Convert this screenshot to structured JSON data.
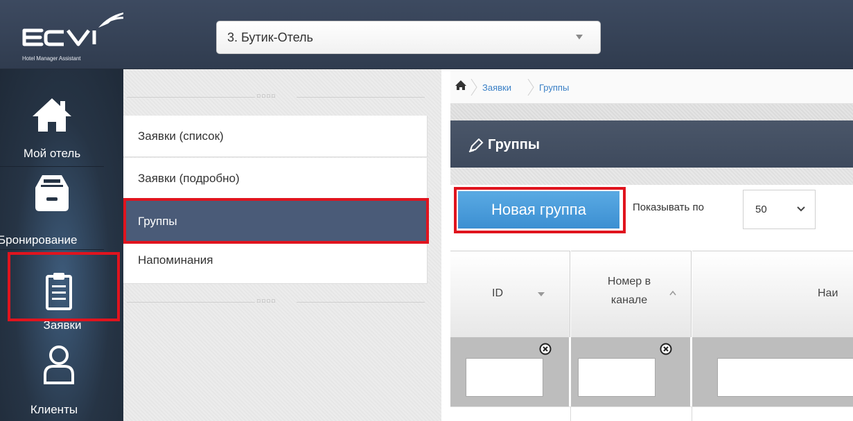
{
  "app": {
    "logo_text": "ECVI",
    "logo_subtitle": "Hotel Manager Assistant"
  },
  "hotel_select": {
    "value": "3. Бутик-Отель"
  },
  "nav": {
    "items": [
      {
        "label": "Мой отель",
        "icon": "home-icon"
      },
      {
        "label": "Бронирование",
        "icon": "inbox-icon"
      },
      {
        "label": "Заявки",
        "icon": "clipboard-icon",
        "active": true
      },
      {
        "label": "Клиенты",
        "icon": "user-icon"
      }
    ]
  },
  "submenu": {
    "items": [
      {
        "label": "Заявки (список)"
      },
      {
        "label": "Заявки (подробно)"
      },
      {
        "label": "Группы",
        "active": true
      },
      {
        "label": "Напоминания"
      }
    ]
  },
  "breadcrumb": {
    "items": [
      "Заявки",
      "Группы"
    ]
  },
  "panel": {
    "title": "Группы",
    "new_button": "Новая группа",
    "show_per_label": "Показывать по",
    "per_page_value": "50"
  },
  "table": {
    "columns": [
      {
        "label": "ID",
        "sort": "desc"
      },
      {
        "label_line1": "Номер в",
        "label_line2": "канале",
        "sort": "asc"
      },
      {
        "label": "Наи"
      }
    ]
  },
  "colors": {
    "highlight": "#e0141e",
    "active_menu": "#4a5b78",
    "primary_button": "#4a9edb",
    "link": "#3b80c6"
  }
}
